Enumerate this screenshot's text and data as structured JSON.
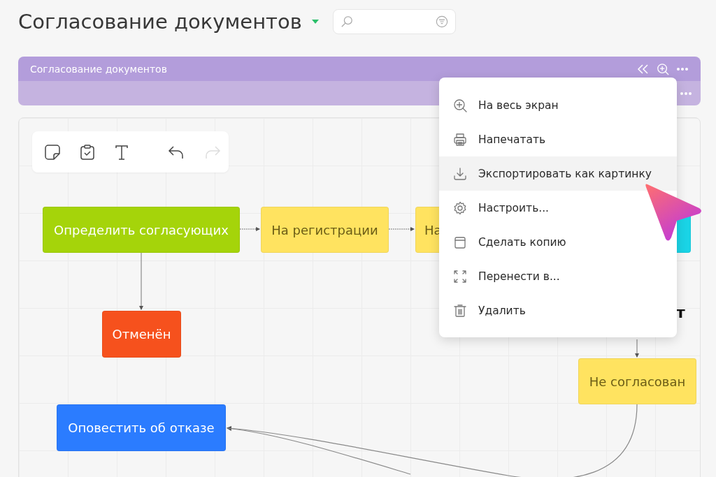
{
  "page": {
    "title": "Согласование документов"
  },
  "board": {
    "title": "Согласование документов"
  },
  "toolbar": {
    "redo_disabled": true
  },
  "diagram": {
    "nodes": [
      {
        "label": "Определить согласующих",
        "color": "#a5d40a"
      },
      {
        "label": "На регистрации",
        "color": "#ffe360"
      },
      {
        "label": "На",
        "color": "#ffe360"
      },
      {
        "color": "#1ad4e6"
      },
      {
        "label": "Отменён",
        "color": "#f6511d"
      },
      {
        "label": "Не согласован",
        "color": "#ffe360"
      },
      {
        "label": "Оповестить об отказе",
        "color": "#2b7cff"
      }
    ],
    "fragment": "т"
  },
  "menu": {
    "items": [
      {
        "label": "На весь экран",
        "kind": "zoom",
        "highlighted": false
      },
      {
        "label": "Напечатать",
        "kind": "print",
        "highlighted": false
      },
      {
        "label": "Экспортировать как картинку",
        "kind": "download",
        "highlighted": true
      },
      {
        "label": "Настроить...",
        "kind": "gear",
        "highlighted": false
      },
      {
        "label": "Сделать копию",
        "kind": "copy",
        "highlighted": false
      },
      {
        "label": "Перенести в...",
        "kind": "move",
        "highlighted": false
      },
      {
        "label": "Удалить",
        "kind": "trash",
        "highlighted": false
      }
    ]
  }
}
